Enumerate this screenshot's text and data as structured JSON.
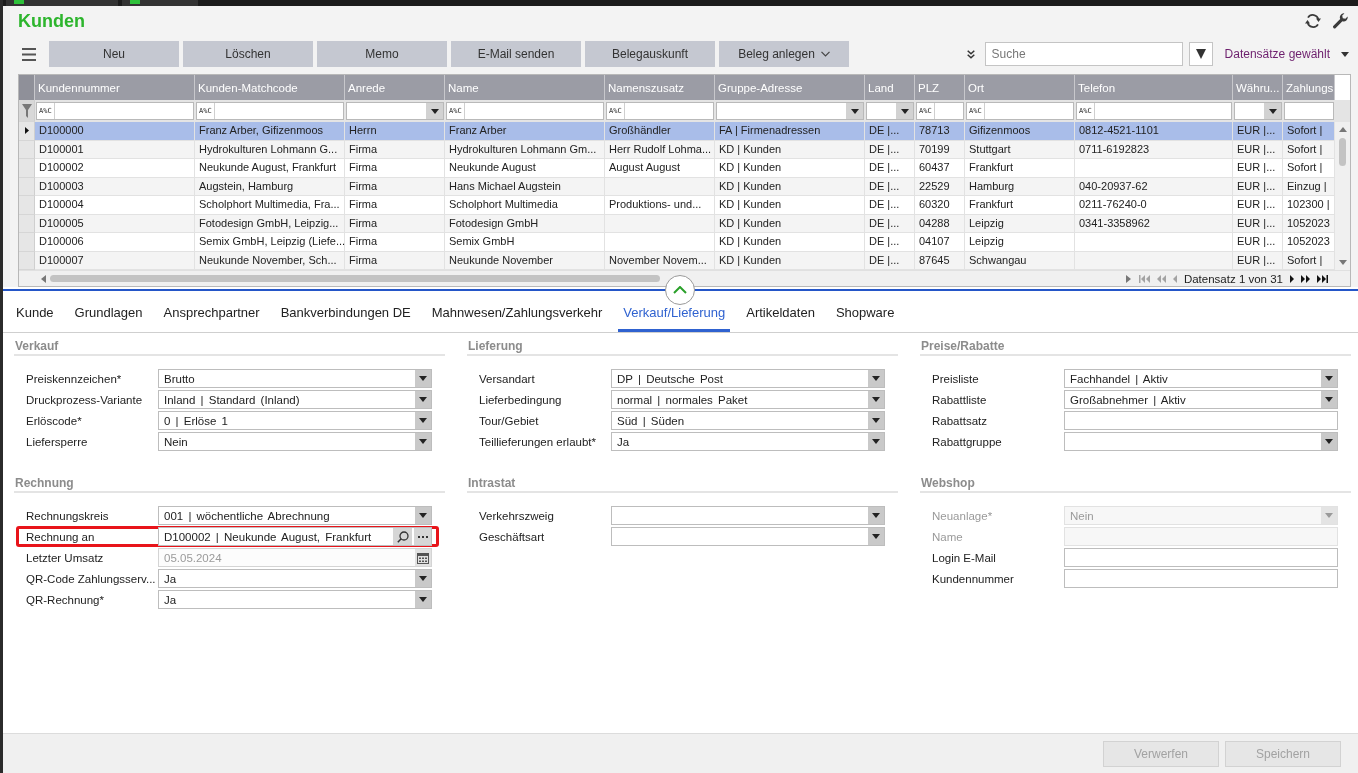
{
  "window": {
    "title": "Kunden"
  },
  "toolbar": {
    "buttons": [
      {
        "label": "Neu",
        "kind": "action"
      },
      {
        "label": "Löschen",
        "kind": "action"
      },
      {
        "label": "Memo",
        "kind": "action"
      },
      {
        "label": "E-Mail senden",
        "kind": "action"
      },
      {
        "label": "Belegauskunft",
        "kind": "action"
      },
      {
        "label": "Beleg anlegen",
        "kind": "menu"
      }
    ],
    "search": {
      "placeholder": "Suche"
    },
    "selection_menu": {
      "label": "Datensätze gewählt"
    }
  },
  "table": {
    "columns": [
      {
        "label": "Kundennummer",
        "filter": {
          "kind": "text",
          "operator": "A%C"
        }
      },
      {
        "label": "Kunden-Matchcode",
        "filter": {
          "kind": "text",
          "operator": "A%C"
        }
      },
      {
        "label": "Anrede",
        "filter": {
          "kind": "select"
        }
      },
      {
        "label": "Name",
        "filter": {
          "kind": "text",
          "operator": "A%C"
        }
      },
      {
        "label": "Namenszusatz",
        "filter": {
          "kind": "text",
          "operator": "A%C"
        }
      },
      {
        "label": "Gruppe-Adresse",
        "filter": {
          "kind": "select"
        }
      },
      {
        "label": "Land",
        "filter": {
          "kind": "select"
        }
      },
      {
        "label": "PLZ",
        "filter": {
          "kind": "text",
          "operator": "A%C"
        }
      },
      {
        "label": "Ort",
        "filter": {
          "kind": "text",
          "operator": "A%C"
        }
      },
      {
        "label": "Telefon",
        "filter": {
          "kind": "text",
          "operator": "A%C"
        }
      },
      {
        "label": "Währu...",
        "filter": {
          "kind": "select"
        }
      },
      {
        "label": "Zahlungs",
        "filter": {
          "kind": "text"
        }
      }
    ],
    "rows": [
      {
        "selected": true,
        "cells": [
          "D100000",
          "Franz Arber, Gifizenmoos",
          "Herrn",
          "Franz Arber",
          "Großhändler",
          "FA | Firmenadressen",
          "DE |...",
          "78713",
          "Gifizenmoos",
          "0812-4521-1101",
          "EUR |...",
          "Sofort |"
        ]
      },
      {
        "selected": false,
        "cells": [
          "D100001",
          "Hydrokulturen Lohmann G...",
          "Firma",
          "Hydrokulturen Lohmann Gm...",
          "Herr Rudolf Lohma...",
          "KD | Kunden",
          "DE |...",
          "70199",
          "Stuttgart",
          "0711-6192823",
          "EUR |...",
          "Sofort |"
        ]
      },
      {
        "selected": false,
        "cells": [
          "D100002",
          "Neukunde August, Frankfurt",
          "Firma",
          "Neukunde August",
          "August August",
          "KD | Kunden",
          "DE |...",
          "60437",
          "Frankfurt",
          null,
          "EUR |...",
          "Sofort |"
        ]
      },
      {
        "selected": false,
        "cells": [
          "D100003",
          "Augstein, Hamburg",
          "Firma",
          "Hans Michael Augstein",
          null,
          "KD | Kunden",
          "DE |...",
          "22529",
          "Hamburg",
          "040-20937-62",
          "EUR |...",
          "Einzug |"
        ]
      },
      {
        "selected": false,
        "cells": [
          "D100004",
          "Scholphort Multimedia, Fra...",
          "Firma",
          "Scholphort Multimedia",
          "Produktions- und...",
          "KD | Kunden",
          "DE |...",
          "60320",
          "Frankfurt",
          "0211-76240-0",
          "EUR |...",
          "102300 |"
        ]
      },
      {
        "selected": false,
        "cells": [
          "D100005",
          "Fotodesign GmbH, Leipzig...",
          "Firma",
          "Fotodesign GmbH",
          null,
          "KD | Kunden",
          "DE |...",
          "04288",
          "Leipzig",
          "0341-3358962",
          "EUR |...",
          "1052023"
        ]
      },
      {
        "selected": false,
        "cells": [
          "D100006",
          "Semix GmbH, Leipzig (Liefe...",
          "Firma",
          "Semix GmbH",
          null,
          "KD | Kunden",
          "DE |...",
          "04107",
          "Leipzig",
          null,
          "EUR |...",
          "1052023"
        ]
      },
      {
        "selected": false,
        "cells": [
          "D100007",
          "Neukunde November, Sch...",
          "Firma",
          "Neukunde November",
          "November Novem...",
          "KD | Kunden",
          "DE |...",
          "87645",
          "Schwangau",
          null,
          "EUR |...",
          "Sofort |"
        ]
      }
    ],
    "pager": {
      "label": "Datensatz 1 von 31",
      "previous_disabled": true,
      "next_disabled": false
    }
  },
  "tabs": [
    {
      "label": "Kunde",
      "selected": false
    },
    {
      "label": "Grundlagen",
      "selected": false
    },
    {
      "label": "Ansprechpartner",
      "selected": false
    },
    {
      "label": "Bankverbindungen DE",
      "selected": false
    },
    {
      "label": "Mahnwesen/Zahlungsverkehr",
      "selected": false
    },
    {
      "label": "Verkauf/Lieferung",
      "selected": true
    },
    {
      "label": "Artikeldaten",
      "selected": false
    },
    {
      "label": "Shopware",
      "selected": false
    }
  ],
  "form": {
    "sections": [
      {
        "title": "Verkauf",
        "fields": [
          {
            "label": "Preiskennzeichen*",
            "kind": "select",
            "value": "Brutto",
            "disabled": false,
            "readonly": false,
            "highlighted": false
          },
          {
            "label": "Druckprozess-Variante",
            "kind": "select",
            "value": "Inland | Standard (Inland)",
            "disabled": false,
            "readonly": false,
            "highlighted": false
          },
          {
            "label": "Erlöscode*",
            "kind": "select",
            "value": "0 | Erlöse 1",
            "disabled": false,
            "readonly": false,
            "highlighted": false
          },
          {
            "label": "Liefersperre",
            "kind": "select",
            "value": "Nein",
            "disabled": false,
            "readonly": false,
            "highlighted": false
          }
        ]
      },
      {
        "title": "Lieferung",
        "fields": [
          {
            "label": "Versandart",
            "kind": "select",
            "value": "DP | Deutsche Post",
            "disabled": false,
            "readonly": false,
            "highlighted": false
          },
          {
            "label": "Lieferbedingung",
            "kind": "select",
            "value": "normal | normales Paket",
            "disabled": false,
            "readonly": false,
            "highlighted": false
          },
          {
            "label": "Tour/Gebiet",
            "kind": "select",
            "value": "Süd | Süden",
            "disabled": false,
            "readonly": false,
            "highlighted": false
          },
          {
            "label": "Teillieferungen erlaubt*",
            "kind": "select",
            "value": "Ja",
            "disabled": false,
            "readonly": false,
            "highlighted": false
          }
        ]
      },
      {
        "title": "Preise/Rabatte",
        "fields": [
          {
            "label": "Preisliste",
            "kind": "select",
            "value": "Fachhandel | Aktiv",
            "disabled": false,
            "readonly": false,
            "highlighted": false
          },
          {
            "label": "Rabattliste",
            "kind": "select",
            "value": "Großabnehmer | Aktiv",
            "disabled": false,
            "readonly": false,
            "highlighted": false
          },
          {
            "label": "Rabattsatz",
            "kind": "text",
            "disabled": false,
            "readonly": false,
            "highlighted": false
          },
          {
            "label": "Rabattgruppe",
            "kind": "select",
            "disabled": false,
            "readonly": false,
            "highlighted": false
          }
        ]
      },
      {
        "title": "Rechnung",
        "fields": [
          {
            "label": "Rechnungskreis",
            "kind": "select",
            "value": "001 | wöchentliche Abrechnung",
            "disabled": false,
            "readonly": false,
            "highlighted": false
          },
          {
            "label": "Rechnung an",
            "kind": "lookup",
            "value": "D100002 | Neukunde August, Frankfurt",
            "disabled": false,
            "readonly": false,
            "highlighted": true
          },
          {
            "label": "Letzter Umsatz",
            "kind": "date",
            "value": "05.05.2024",
            "disabled": false,
            "readonly": true,
            "highlighted": false
          },
          {
            "label": "QR-Code Zahlungsserv...",
            "kind": "select",
            "value": "Ja",
            "disabled": false,
            "readonly": false,
            "highlighted": false
          },
          {
            "label": "QR-Rechnung*",
            "kind": "select",
            "value": "Ja",
            "disabled": false,
            "readonly": false,
            "highlighted": false
          }
        ]
      },
      {
        "title": "Intrastat",
        "fields": [
          {
            "label": "Verkehrszweig",
            "kind": "select",
            "disabled": false,
            "readonly": false,
            "highlighted": false
          },
          {
            "label": "Geschäftsart",
            "kind": "select",
            "disabled": false,
            "readonly": false,
            "highlighted": false
          }
        ]
      },
      {
        "title": "Webshop",
        "fields": [
          {
            "label": "Neuanlage*",
            "kind": "select",
            "value": "Nein",
            "disabled": true,
            "readonly": false,
            "highlighted": false
          },
          {
            "label": "Name",
            "kind": "text",
            "disabled": true,
            "readonly": false,
            "highlighted": false
          },
          {
            "label": "Login E-Mail",
            "kind": "text",
            "disabled": false,
            "readonly": false,
            "highlighted": false
          },
          {
            "label": "Kundennummer",
            "kind": "text",
            "disabled": false,
            "readonly": false,
            "highlighted": false
          }
        ]
      }
    ]
  },
  "footer": {
    "buttons": [
      {
        "label": "Verwerfen",
        "disabled": true
      },
      {
        "label": "Speichern",
        "disabled": true
      }
    ]
  }
}
